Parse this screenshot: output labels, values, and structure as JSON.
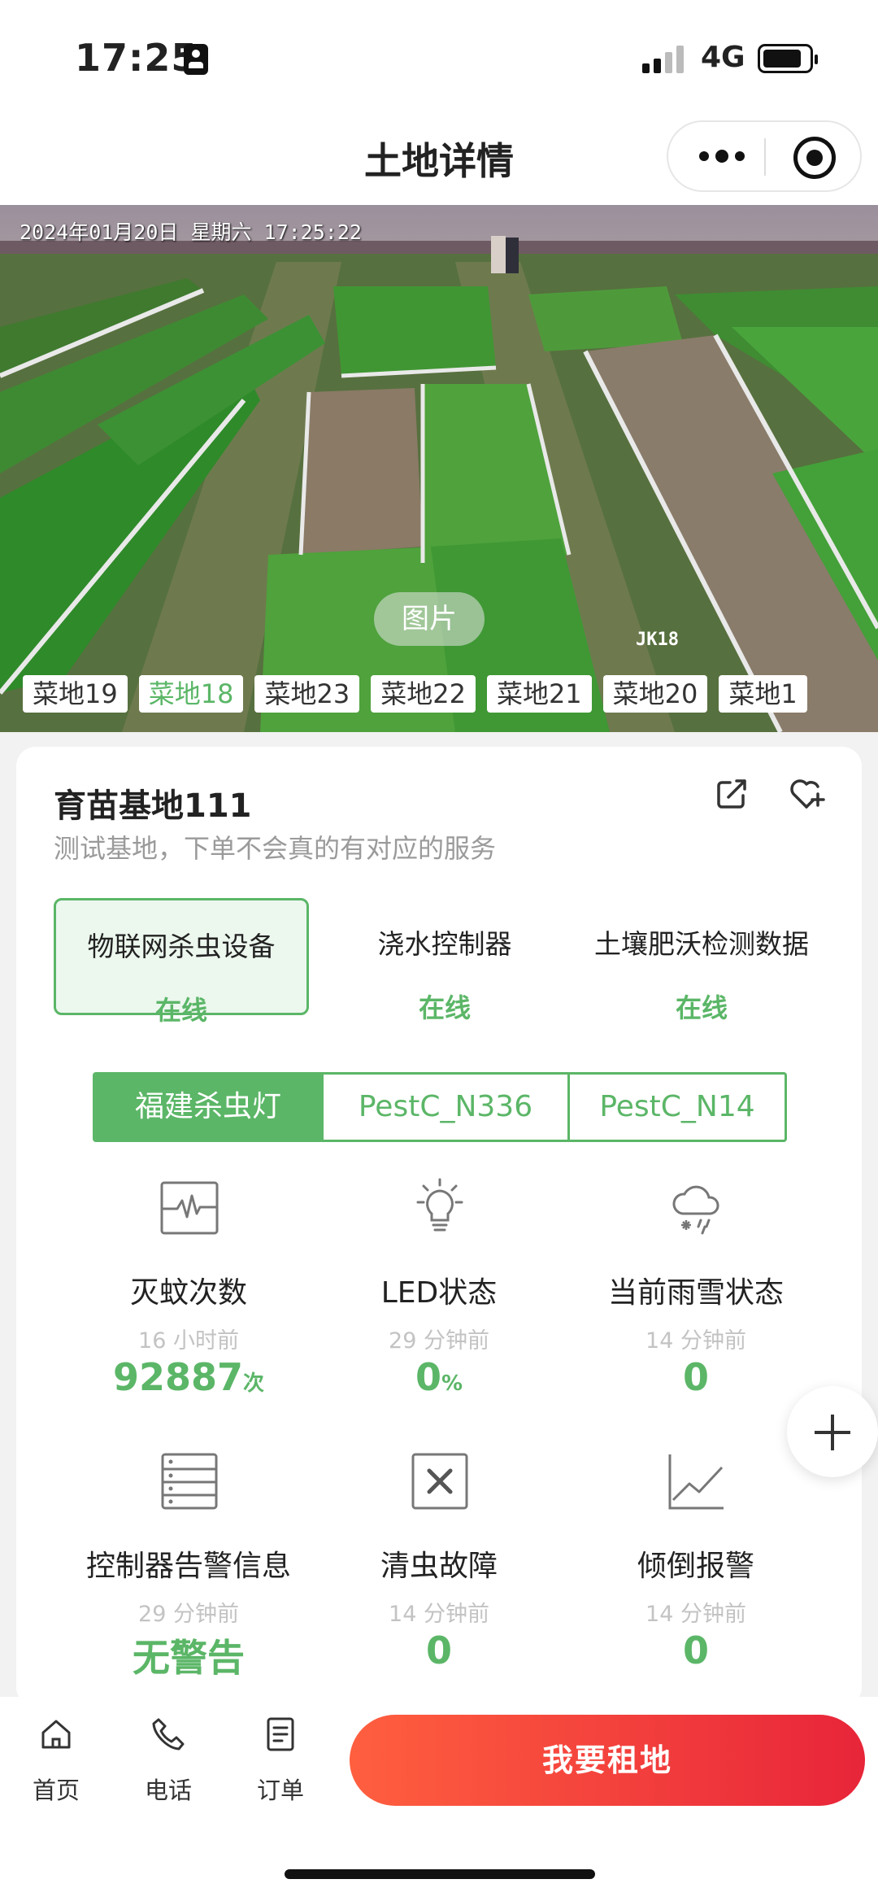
{
  "status_bar": {
    "time": "17:25",
    "network": "4G"
  },
  "nav": {
    "title": "土地详情"
  },
  "camera": {
    "timestamp": "2024年01月20日  星期六  17:25:22",
    "camera_code": "JK18",
    "image_tag": "图片",
    "plots": [
      {
        "label": "菜地19",
        "active": false
      },
      {
        "label": "菜地18",
        "active": true
      },
      {
        "label": "菜地23",
        "active": false
      },
      {
        "label": "菜地22",
        "active": false
      },
      {
        "label": "菜地21",
        "active": false
      },
      {
        "label": "菜地20",
        "active": false
      },
      {
        "label": "菜地1",
        "active": false
      }
    ]
  },
  "base": {
    "name": "育苗基地111",
    "description": "测试基地，下单不会真的有对应的服务"
  },
  "device_tabs": [
    {
      "name": "物联网杀虫设备",
      "status": "在线",
      "active": true
    },
    {
      "name": "浇水控制器",
      "status": "在线",
      "active": false
    },
    {
      "name": "土壤肥沃检测数据",
      "status": "在线",
      "active": false
    }
  ],
  "segments": [
    {
      "label": "福建杀虫灯",
      "active": true
    },
    {
      "label": "PestC_N336",
      "active": false
    },
    {
      "label": "PestC_N14",
      "active": false
    }
  ],
  "metrics": [
    {
      "name": "灭蚊次数",
      "time": "16 小时前",
      "value": "92887",
      "unit": "次",
      "icon": "waveform-icon"
    },
    {
      "name": "LED状态",
      "time": "29 分钟前",
      "value": "0",
      "unit": "%",
      "icon": "lightbulb-icon"
    },
    {
      "name": "当前雨雪状态",
      "time": "14 分钟前",
      "value": "0",
      "unit": "",
      "icon": "snow-cloud-icon"
    },
    {
      "name": "控制器告警信息",
      "time": "29 分钟前",
      "value": "无警告",
      "unit": "",
      "icon": "server-icon"
    },
    {
      "name": "清虫故障",
      "time": "14 分钟前",
      "value": "0",
      "unit": "",
      "icon": "close-box-icon"
    },
    {
      "name": "倾倒报警",
      "time": "14 分钟前",
      "value": "0",
      "unit": "",
      "icon": "line-chart-icon"
    }
  ],
  "bottom_nav": [
    {
      "label": "首页",
      "icon": "home-icon"
    },
    {
      "label": "电话",
      "icon": "phone-icon"
    },
    {
      "label": "订单",
      "icon": "order-icon"
    }
  ],
  "cta": {
    "label": "我要租地"
  },
  "colors": {
    "accent_green": "#5bb667",
    "cta_start": "#ff5f3f",
    "cta_end": "#e8253a"
  }
}
